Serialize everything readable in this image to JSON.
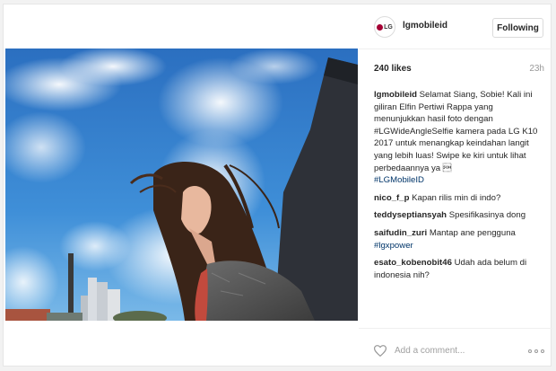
{
  "post": {
    "image_alt": "Woman taking a wide-angle selfie under a blue sky with clouds",
    "account": {
      "avatar_text": "LG",
      "username": "lgmobileid",
      "follow_label": "Following"
    },
    "likes": "240 likes",
    "time_ago": "23h",
    "caption": {
      "author": "lgmobileid",
      "text": "Selamat Siang, Sobie! Kali ini giliran Elfin Pertiwi Rappa yang menunjukkan hasil foto dengan #LGWideAngleSelfie kamera pada LG K10 2017 untuk menangkap keindahan langit yang lebih luas! Swipe ke kiri untuk lihat perbedaannya ya \u0001",
      "hashtag": "#LGMobileID"
    },
    "comments": [
      {
        "author": "nico_f_p",
        "text": "Kapan rilis min di indo?"
      },
      {
        "author": "teddyseptiansyah",
        "text": "Spesifikasinya dong"
      },
      {
        "author": "saifudin_zuri",
        "text": "Mantap ane pengguna",
        "hashtag": "#lgxpower"
      },
      {
        "author": "esato_kobenobit46",
        "text": "Udah ada belum di indonesia nih?"
      }
    ],
    "comment_input": {
      "placeholder": "Add a comment..."
    },
    "icons": {
      "like": "heart-icon",
      "more": "more-options-icon"
    },
    "colors": {
      "link": "#003569",
      "muted": "#999999",
      "brand": "#a50034"
    }
  }
}
